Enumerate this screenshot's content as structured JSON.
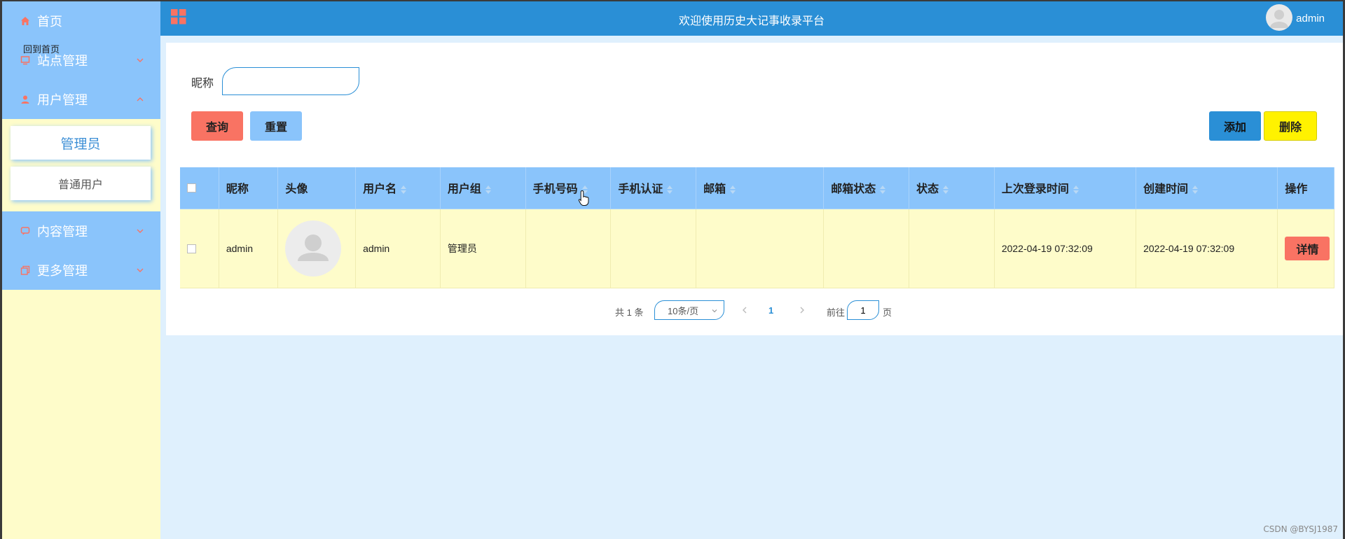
{
  "colors": {
    "header": "#2a8fd6",
    "sidebar_menu": "#8ac4fb",
    "sidebar_bg": "#fefcca",
    "danger": "#f97363",
    "warning": "#fff200",
    "page_bg": "#dff0fd"
  },
  "sidebar": {
    "tooltip": "回到首页",
    "items": [
      {
        "label": "首页",
        "icon": "home-icon"
      },
      {
        "label": "站点管理",
        "icon": "monitor-icon"
      },
      {
        "label": "用户管理",
        "icon": "user-icon"
      },
      {
        "label": "内容管理",
        "icon": "message-icon"
      },
      {
        "label": "更多管理",
        "icon": "copy-icon"
      }
    ],
    "submenu": [
      {
        "label": "管理员"
      },
      {
        "label": "普通用户"
      }
    ]
  },
  "header": {
    "title": "欢迎使用历史大记事收录平台",
    "username": "admin"
  },
  "search": {
    "label": "昵称",
    "value": "",
    "placeholder": ""
  },
  "toolbar": {
    "query": "查询",
    "reset": "重置",
    "add": "添加",
    "delete": "删除"
  },
  "table": {
    "columns": [
      "昵称",
      "头像",
      "用户名",
      "用户组",
      "手机号码",
      "手机认证",
      "邮箱",
      "邮箱状态",
      "状态",
      "上次登录时间",
      "创建时间",
      "操作"
    ],
    "rows": [
      {
        "nickname": "admin",
        "username": "admin",
        "group": "管理员",
        "phone": "",
        "phone_verified": "",
        "email": "",
        "email_status": "",
        "status": "",
        "last_login": "2022-04-19 07:32:09",
        "created": "2022-04-19 07:32:09",
        "action": "详情"
      }
    ]
  },
  "pagination": {
    "total": "共 1 条",
    "page_size": "10条/页",
    "current_page": "1",
    "goto_prefix": "前往",
    "goto_value": "1",
    "goto_suffix": "页"
  },
  "watermark": "CSDN @BYSJ1987"
}
